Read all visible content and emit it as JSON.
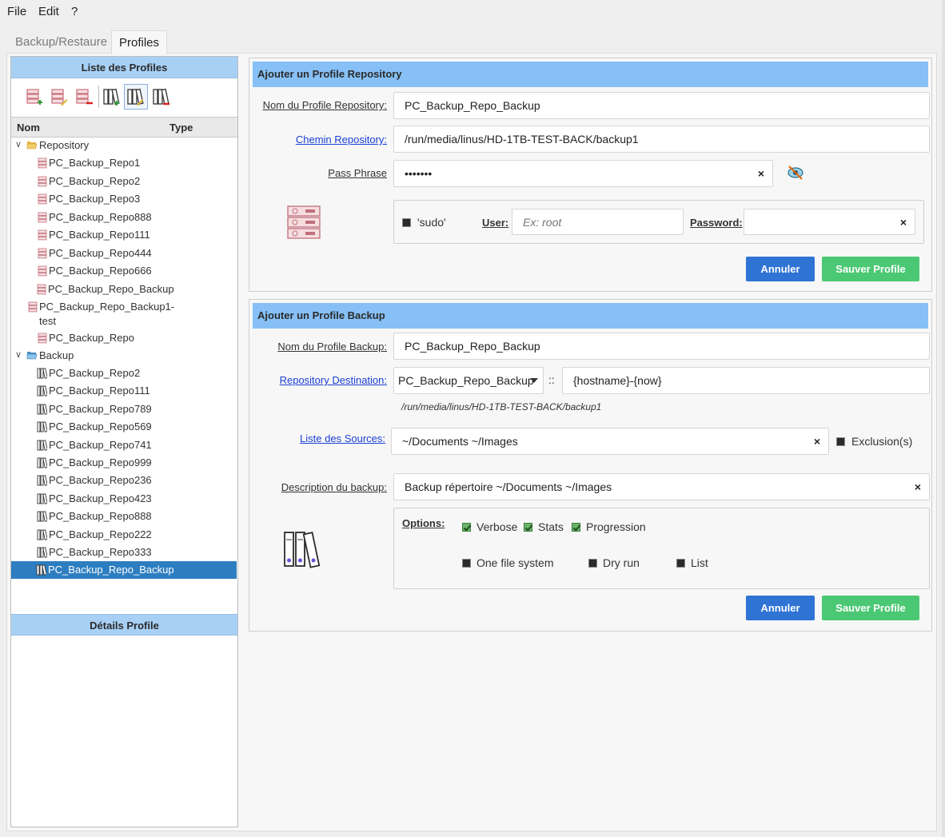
{
  "menu": {
    "file": "File",
    "edit": "Edit",
    "help": "?"
  },
  "tabs": [
    {
      "label": "Backup/Restaure"
    },
    {
      "label": "Profiles"
    }
  ],
  "left": {
    "profiles_title": "Liste des Profiles",
    "details_title": "Détails Profile",
    "col_name": "Nom",
    "col_type": "Type",
    "tree": {
      "repository_label": "Repository",
      "repositories": [
        "PC_Backup_Repo1",
        "PC_Backup_Repo2",
        "PC_Backup_Repo3",
        "PC_Backup_Repo888",
        "PC_Backup_Repo111",
        "PC_Backup_Repo444",
        "PC_Backup_Repo666",
        "PC_Backup_Repo_Backup",
        "PC_Backup_Repo_Backup1-",
        "test",
        "PC_Backup_Repo"
      ],
      "backup_label": "Backup",
      "backups": [
        "PC_Backup_Repo2",
        "PC_Backup_Repo111",
        "PC_Backup_Repo789",
        "PC_Backup_Repo569",
        "PC_Backup_Repo741",
        "PC_Backup_Repo999",
        "PC_Backup_Repo236",
        "PC_Backup_Repo423",
        "PC_Backup_Repo888",
        "PC_Backup_Repo222",
        "PC_Backup_Repo333",
        "PC_Backup_Repo_Backup"
      ]
    }
  },
  "repo_form": {
    "title": "Ajouter un Profile Repository",
    "name_label": "Nom du Profile Repository:",
    "name_value": "PC_Backup_Repo_Backup",
    "path_label": "Chemin Repository:",
    "path_value": "/run/media/linus/HD-1TB-TEST-BACK/backup1",
    "pass_label": "Pass Phrase",
    "pass_value": "•••••••",
    "clear": "×",
    "sudo_label": "'sudo'",
    "user_label": "User:",
    "user_placeholder": "Ex: root",
    "password_label": "Password:",
    "cancel": "Annuler",
    "save": "Sauver Profile"
  },
  "backup_form": {
    "title": "Ajouter un Profile Backup",
    "name_label": "Nom du Profile Backup:",
    "name_value": "PC_Backup_Repo_Backup",
    "dest_label": "Repository Destination:",
    "dest_value": "PC_Backup_Repo_Backup",
    "separator": "::",
    "archive_value": "{hostname}-{now}",
    "dest_path": "/run/media/linus/HD-1TB-TEST-BACK/backup1",
    "sources_label": "Liste des Sources:",
    "sources_value": "~/Documents ~/Images",
    "exclusion_label": "Exclusion(s)",
    "desc_label": "Description du backup:",
    "desc_value": "Backup répertoire ~/Documents ~/Images",
    "options_label": "Options:",
    "opt_verbose": "Verbose",
    "opt_stats": "Stats",
    "opt_progress": "Progression",
    "opt_onefs": "One file system",
    "opt_dryrun": "Dry run",
    "opt_list": "List",
    "cancel": "Annuler",
    "save": "Sauver Profile"
  },
  "colors": {
    "header_blue": "#86c0f6",
    "select_blue": "#2d7ec1",
    "btn_blue": "#2f73d4",
    "btn_green": "#4bc873"
  }
}
